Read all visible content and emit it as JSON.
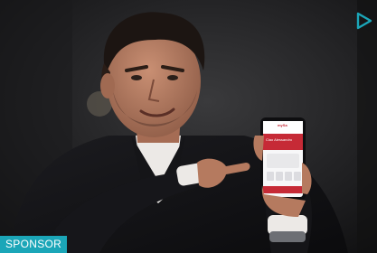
{
  "ad": {
    "sponsor_label": "SPONSOR",
    "play_icon": "play-triangle-icon",
    "accent_color": "#1ba6b8",
    "brand_red": "#c62a36"
  },
  "phone": {
    "brand_text": "mySa",
    "greeting": "Ciao Alessandro"
  }
}
